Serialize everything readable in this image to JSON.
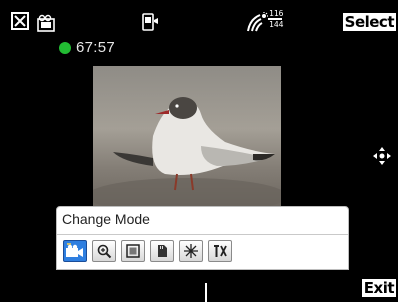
{
  "status_bar": {
    "softkey_select": "Select",
    "signal_top": "116",
    "signal_bottom": "144",
    "icons": [
      "close-icon",
      "video-camera-icon",
      "phone-camera-icon",
      "signal-icon",
      "battery-icon"
    ]
  },
  "recording": {
    "indicator_color": "#22bb33",
    "time": "67:57"
  },
  "preview": {
    "subject": "seagull"
  },
  "mode_panel": {
    "title": "Change Mode",
    "buttons": [
      {
        "name": "video-mode",
        "icon": "video-camera-icon",
        "active": true
      },
      {
        "name": "zoom",
        "icon": "magnifier-icon",
        "active": false
      },
      {
        "name": "frame",
        "icon": "frame-icon",
        "active": false
      },
      {
        "name": "storage",
        "icon": "memory-card-icon",
        "active": false
      },
      {
        "name": "effects",
        "icon": "sparkle-icon",
        "active": false
      },
      {
        "name": "settings",
        "icon": "tools-icon",
        "active": false
      }
    ],
    "active_color": "#2f7fe0"
  },
  "bottom_bar": {
    "softkey_exit": "Exit"
  }
}
